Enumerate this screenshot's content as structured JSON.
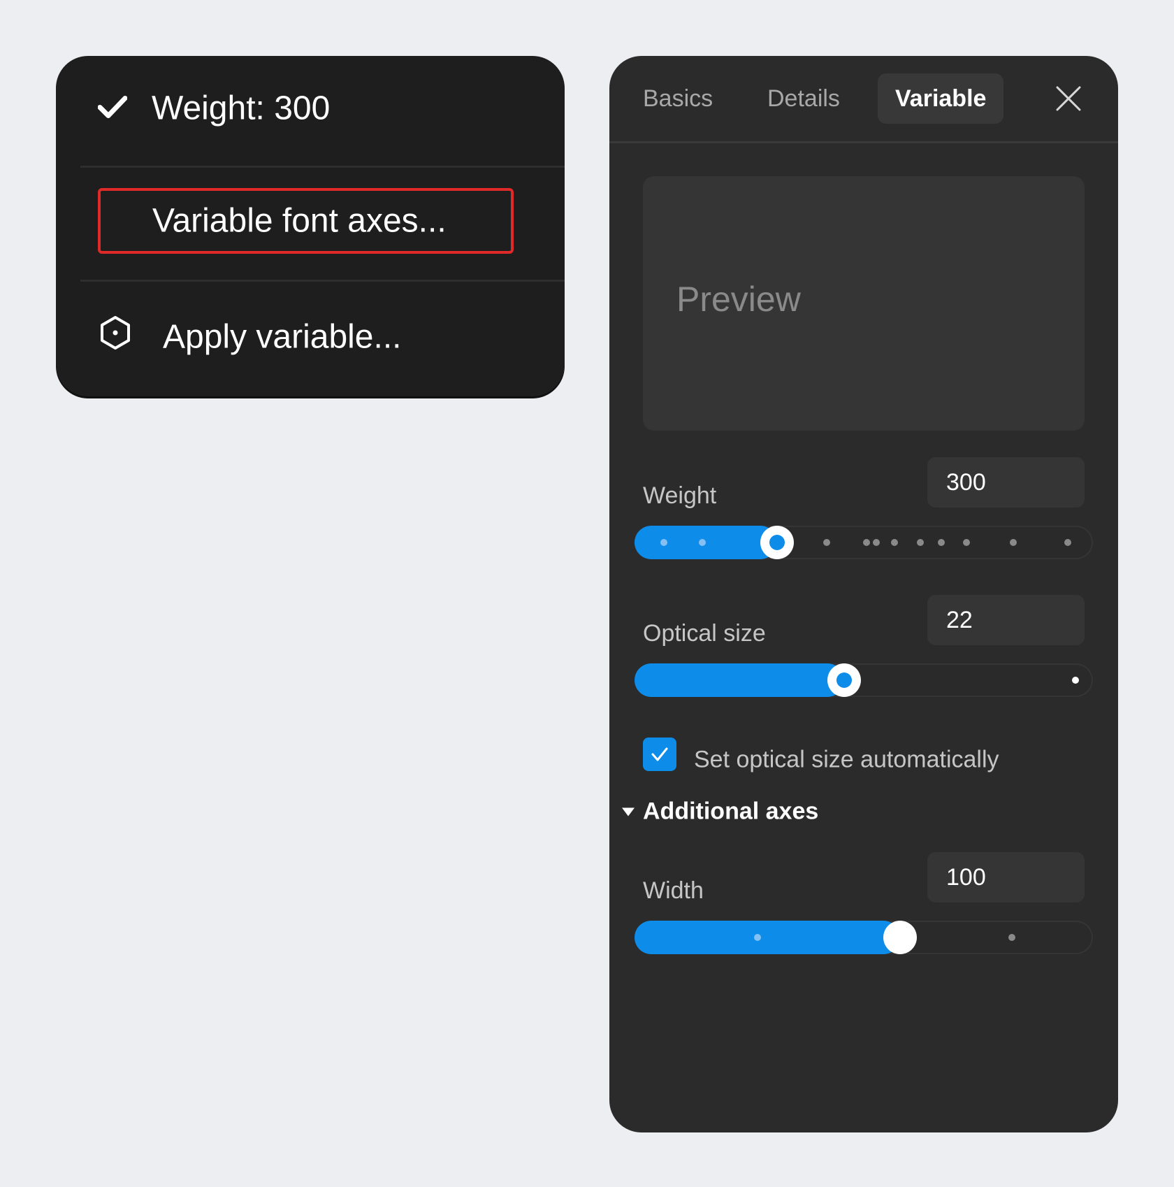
{
  "context_menu": {
    "weight_item": {
      "label": "Weight: 300",
      "icon": "checkmark-icon"
    },
    "axes_item": {
      "label": "Variable font axes..."
    },
    "apply_item": {
      "label": "Apply variable...",
      "icon": "hexagon-icon"
    },
    "highlight_color": "#e02a2a"
  },
  "panel": {
    "tabs": [
      {
        "label": "Basics",
        "active": false
      },
      {
        "label": "Details",
        "active": false
      },
      {
        "label": "Variable",
        "active": true
      }
    ],
    "close_icon": "close-icon",
    "preview_text": "Preview",
    "axes": {
      "weight": {
        "label": "Weight",
        "value": "300",
        "fraction": 0.31
      },
      "optical_size": {
        "label": "Optical size",
        "value": "22",
        "fraction": 0.46
      },
      "width": {
        "label": "Width",
        "value": "100",
        "fraction": 0.58
      }
    },
    "auto_optical_size": {
      "label": "Set optical size automatically",
      "checked": true
    },
    "additional_section": {
      "label": "Additional axes",
      "expanded": true
    },
    "accent_color": "#0d8ce9"
  }
}
